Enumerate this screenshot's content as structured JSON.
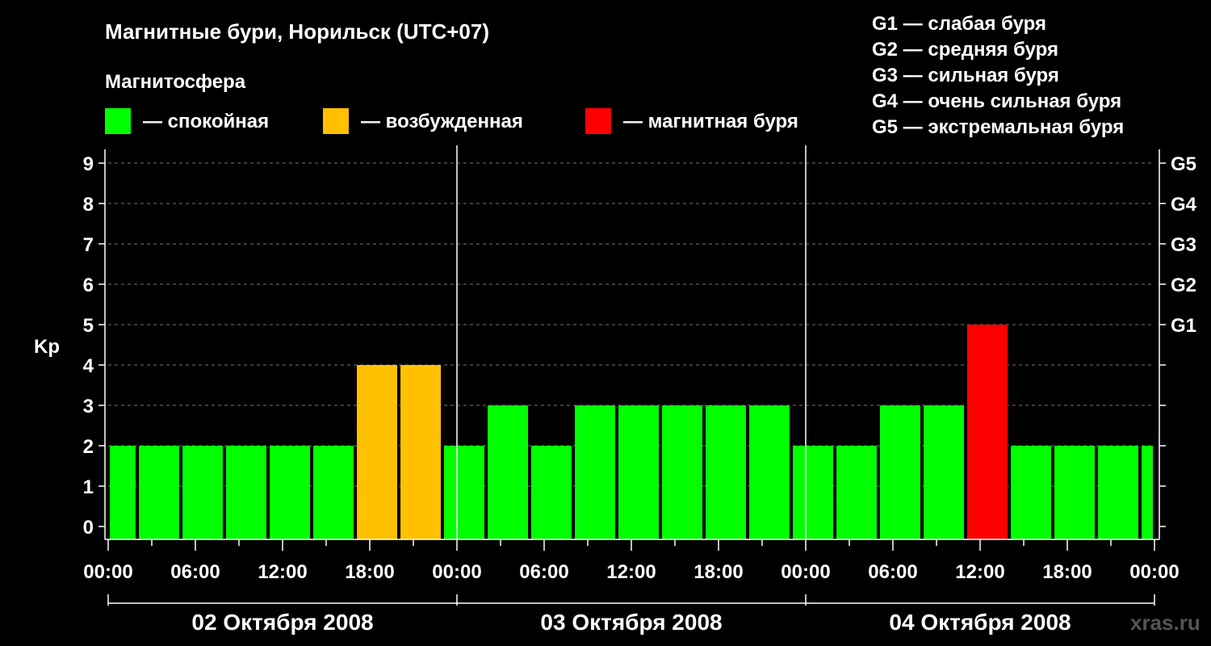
{
  "title": "Магнитные бури, Норильск (UTC+07)",
  "subtitle": "Магнитосфера",
  "legend": [
    {
      "label": "— спокойная",
      "color": "#00ff00"
    },
    {
      "label": "— возбужденная",
      "color": "#ffc000"
    },
    {
      "label": "— магнитная буря",
      "color": "#ff0000"
    }
  ],
  "g_legend": [
    "G1 — слабая буря",
    "G2 — средняя буря",
    "G3 — сильная буря",
    "G4 — очень сильная буря",
    "G5 — экстремальная буря"
  ],
  "watermark": "xras.ru",
  "chart_data": {
    "type": "bar",
    "ylabel": "Kp",
    "ylim": [
      0,
      9
    ],
    "y_ticks": [
      "0",
      "1",
      "2",
      "3",
      "4",
      "5",
      "6",
      "7",
      "8",
      "9"
    ],
    "right_ticks": [
      "G1",
      "G2",
      "G3",
      "G4",
      "G5"
    ],
    "right_tick_values": [
      5,
      6,
      7,
      8,
      9
    ],
    "grid": "dashed, horizontal",
    "x_ticks": [
      "00:00",
      "06:00",
      "12:00",
      "18:00",
      "00:00",
      "06:00",
      "12:00",
      "18:00",
      "00:00",
      "06:00",
      "12:00",
      "18:00",
      "00:00"
    ],
    "dates": [
      "02 Октября 2008",
      "03 Октября 2008",
      "04 Октября 2008"
    ],
    "bin_hours": 3,
    "first_bin_start_hour": -1,
    "values": [
      2,
      2,
      2,
      2,
      2,
      2,
      4,
      4,
      2,
      3,
      2,
      3,
      3,
      3,
      3,
      3,
      2,
      2,
      3,
      3,
      5,
      2,
      2,
      2,
      2
    ],
    "colors": {
      "quiet": "#00ff00",
      "active": "#ffc000",
      "storm": "#ff0000"
    }
  }
}
